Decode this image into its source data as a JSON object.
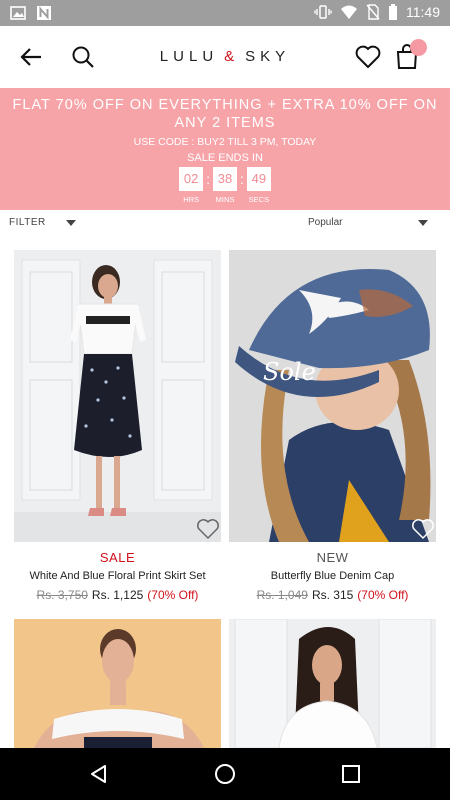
{
  "status_bar": {
    "time": "11:49",
    "icons": [
      "image-icon",
      "n-notification-icon",
      "vibrate-icon",
      "wifi-icon",
      "no-sim-icon",
      "battery-icon"
    ]
  },
  "header": {
    "brand_left": "LULU",
    "brand_amp": "&",
    "brand_right": "SKY",
    "cart_count": "",
    "icons": [
      "back-arrow-icon",
      "search-icon",
      "wishlist-heart-icon",
      "shopping-bag-icon"
    ]
  },
  "promo": {
    "headline": "FLAT 70% OFF ON EVERYTHING +  EXTRA 10% OFF ON ANY 2 ITEMS",
    "code_line": "USE CODE : BUY2   TILL 3 PM, TODAY",
    "ends_label": "SALE ENDS IN",
    "timer": {
      "hours": "02",
      "minutes": "38",
      "seconds": "49",
      "hours_label": "HRS",
      "minutes_label": "MINS",
      "seconds_label": "SECS"
    },
    "colors": {
      "background": "#f7a4a9",
      "digits": "#f28b92"
    }
  },
  "toolbar": {
    "filter_label": "FILTER",
    "sort_label": "Popular"
  },
  "products": [
    {
      "tag": "SALE",
      "tag_color": "#d0121b",
      "name": "White And Blue Floral Print Skirt Set",
      "mrp": "Rs. 3,750",
      "price": "Rs. 1,125",
      "discount": "(70% Off)"
    },
    {
      "tag": "NEW",
      "tag_color": "#555555",
      "name": "Butterfly Blue Denim Cap",
      "mrp": "Rs. 1,049",
      "price": "Rs. 315",
      "discount": "(70% Off)",
      "cap_text": "Sole"
    },
    {
      "tag": "",
      "name": "",
      "mrp": "",
      "price": "",
      "discount": ""
    },
    {
      "tag": "",
      "name": "",
      "mrp": "",
      "price": "",
      "discount": ""
    }
  ],
  "nav_bar": {
    "icons": [
      "back-triangle-icon",
      "home-circle-icon",
      "recents-square-icon"
    ]
  }
}
